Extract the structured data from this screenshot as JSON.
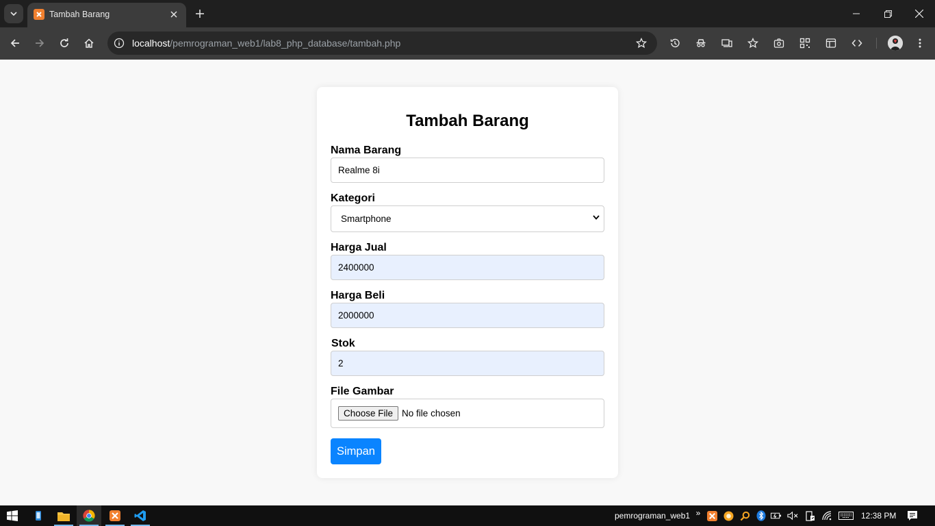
{
  "browser": {
    "tab_title": "Tambah Barang",
    "url_host": "localhost",
    "url_path": "/pemrograman_web1/lab8_php_database/tambah.php"
  },
  "form": {
    "title": "Tambah Barang",
    "nama_label": "Nama Barang",
    "nama_value": "Realme 8i",
    "kategori_label": "Kategori",
    "kategori_value": "Smartphone",
    "harga_jual_label": "Harga Jual",
    "harga_jual_value": "2400000",
    "harga_beli_label": "Harga Beli",
    "harga_beli_value": "2000000",
    "stok_label": "Stok",
    "stok_value": "2",
    "file_label": "File Gambar",
    "file_button": "Choose File",
    "file_status": "No file chosen",
    "submit_label": "Simpan"
  },
  "taskbar": {
    "window_label": "pemrograman_web1",
    "overflow": "»",
    "time": "12:38 PM"
  },
  "colors": {
    "accent": "#0a84ff",
    "autofill": "#e8f0fe",
    "chrome_dark": "#1f1f1f",
    "chrome_toolbar": "#3c3c3c"
  }
}
